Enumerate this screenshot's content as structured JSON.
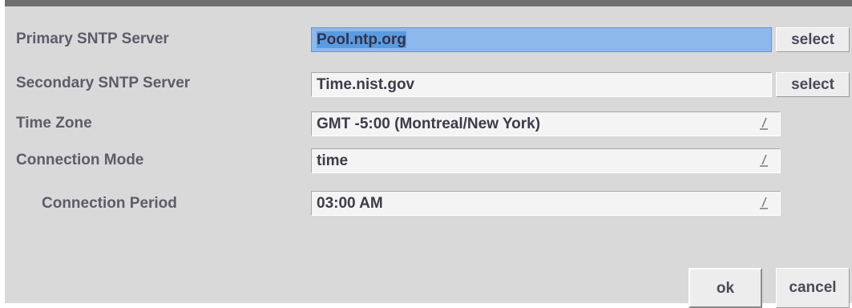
{
  "form": {
    "primary_sntp": {
      "label": "Primary SNTP Server",
      "value": "Pool.ntp.org",
      "button": "select"
    },
    "secondary_sntp": {
      "label": "Secondary SNTP Server",
      "value": "Time.nist.gov",
      "button": "select"
    },
    "time_zone": {
      "label": "Time Zone",
      "value": "GMT -5:00 (Montreal/New York)"
    },
    "connection_mode": {
      "label": "Connection Mode",
      "value": "time"
    },
    "connection_period": {
      "label": "Connection Period",
      "value": "03:00 AM"
    }
  },
  "buttons": {
    "ok": "ok",
    "cancel": "cancel"
  },
  "colors": {
    "dialog_background": "#d9d9d9",
    "focus_highlight": "#8db8ec",
    "text_selection": "#5a9be0",
    "label_text": "#5c5c6a"
  }
}
